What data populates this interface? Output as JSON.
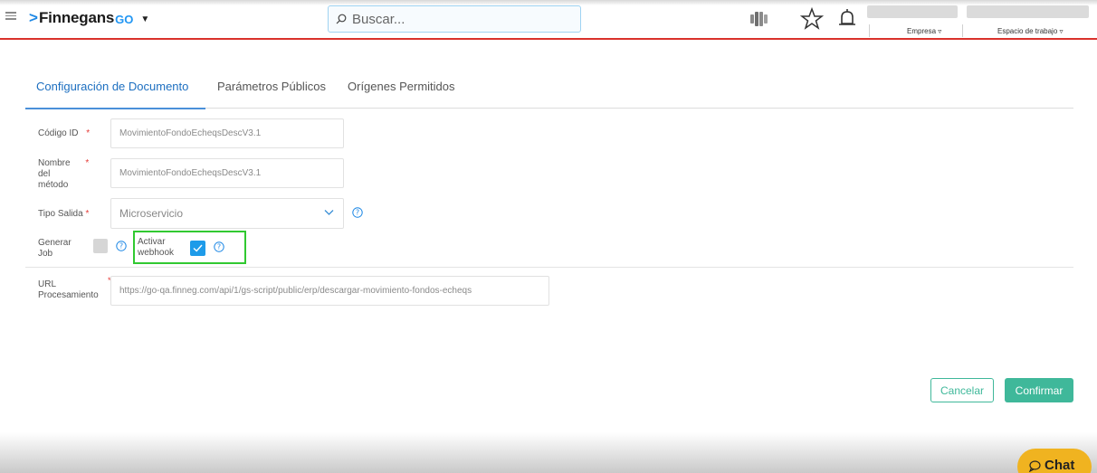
{
  "header": {
    "brand_name": "Finnegans",
    "brand_suffix": "GO",
    "search_placeholder": "Buscar...",
    "empresa_label": "Empresa",
    "workspace_label": "Espacio de trabajo"
  },
  "tabs": [
    {
      "label": "Configuración de Documento",
      "active": true
    },
    {
      "label": "Parámetros Públicos",
      "active": false
    },
    {
      "label": "Orígenes Permitidos",
      "active": false
    }
  ],
  "form": {
    "codigo_id": {
      "label": "Código ID",
      "required_mark": "*",
      "value": "MovimientoFondoEcheqsDescV3.1"
    },
    "nombre_metodo": {
      "label_lines": [
        "Nombre",
        "del",
        "método"
      ],
      "required_mark": "*",
      "value": "MovimientoFondoEcheqsDescV3.1"
    },
    "tipo_salida": {
      "label": "Tipo Salida",
      "required_mark": "*",
      "value": "Microservicio"
    },
    "generar_job": {
      "label_lines": [
        "Generar",
        "Job"
      ],
      "checked": false
    },
    "activar_webhook": {
      "label_lines": [
        "Activar",
        "webhook"
      ],
      "checked": true
    },
    "url_procesamiento": {
      "label_lines": [
        "URL",
        "Procesamiento"
      ],
      "required_mark": "*",
      "value": "https://go-qa.finneg.com/api/1/gs-script/public/erp/descargar-movimiento-fondos-echeqs"
    }
  },
  "buttons": {
    "cancel": "Cancelar",
    "confirm": "Confirmar"
  },
  "chat": {
    "label": "Chat"
  },
  "colors": {
    "accent_blue": "#1d6fc0",
    "brand_red_line": "#d9312b",
    "confirm_green": "#3fb89a",
    "highlight_green": "#31c931",
    "chat_yellow": "#f0b320"
  }
}
